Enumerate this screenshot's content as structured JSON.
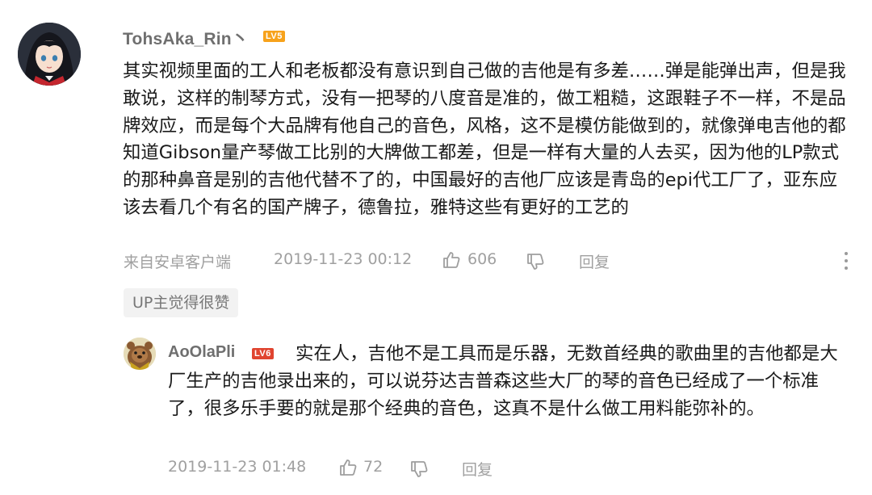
{
  "comment": {
    "username": "TohsAka_Rin丶",
    "level": "LV5",
    "text": "其实视频里面的工人和老板都没有意识到自己做的吉他是有多差……弹是能弹出声，但是我敢说，这样的制琴方式，没有一把琴的八度音是准的，做工粗糙，这跟鞋子不一样，不是品牌效应，而是每个大品牌有他自己的音色，风格，这不是模仿能做到的，就像弹电吉他的都知道Gibson量产琴做工比别的大牌做工都差，但是一样有大量的人去买，因为他的LP款式的那种鼻音是别的吉他代替不了的，中国最好的吉他厂应该是青岛的epi代工厂了，亚东应该去看几个有名的国产牌子，德鲁拉，雅特这些有更好的工艺的",
    "source": "来自安卓客户端",
    "timestamp": "2019-11-23 00:12",
    "likes": "606",
    "reply_label": "回复",
    "up_badge": "UP主觉得很赞"
  },
  "reply": {
    "username": "AoOlaPli",
    "level": "LV6",
    "text": "实在人，吉他不是工具而是乐器，无数首经典的歌曲里的吉他都是大厂生产的吉他录出来的，可以说芬达吉普森这些大厂的琴的音色已经成了一个标准了，很多乐手要的就是那个经典的音色，这真不是什么做工用料能弥补的。",
    "timestamp": "2019-11-23 01:48",
    "likes": "72",
    "reply_label": "回复"
  },
  "colors": {
    "level5": "#f7a21b",
    "level6": "#e0442f",
    "meta_text": "#a0a0a0",
    "username": "#6f6f6f"
  },
  "icons": [
    "thumbs-up-icon",
    "thumbs-down-icon",
    "more-options-icon"
  ]
}
